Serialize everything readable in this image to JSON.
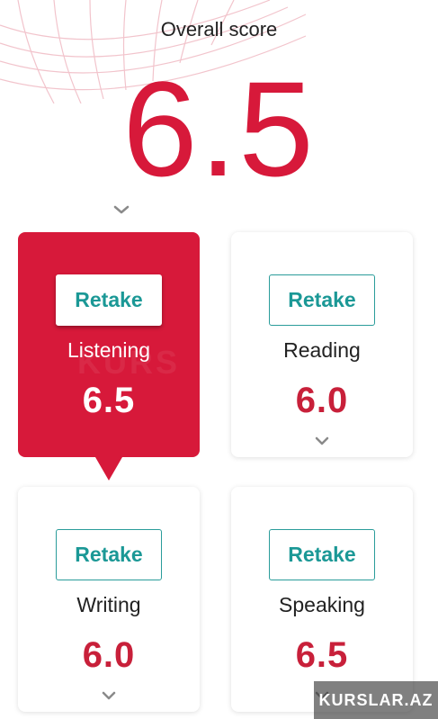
{
  "overall": {
    "label": "Overall score",
    "score": "6.5"
  },
  "cards": [
    {
      "label": "Listening",
      "score": "6.5",
      "retake_label": "Retake",
      "selected": true
    },
    {
      "label": "Reading",
      "score": "6.0",
      "retake_label": "Retake",
      "selected": false
    },
    {
      "label": "Writing",
      "score": "6.0",
      "retake_label": "Retake",
      "selected": false
    },
    {
      "label": "Speaking",
      "score": "6.5",
      "retake_label": "Retake",
      "selected": false
    }
  ],
  "watermark": {
    "faint_text": "KURS",
    "badge_text": "KURSLAR.AZ"
  },
  "colors": {
    "accent_red": "#d7193a",
    "teal": "#1b9896",
    "chevron_gray": "#8a8a8a"
  },
  "icons": {
    "expand": "chevron-down-icon"
  }
}
